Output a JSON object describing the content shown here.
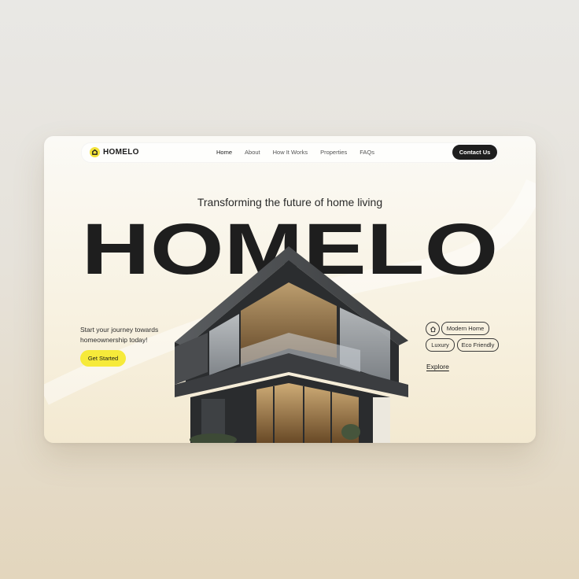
{
  "brand": {
    "logo_text": "HOMELO",
    "logo_icon": "house-icon",
    "accent": "#f6ea3a"
  },
  "nav": {
    "links": [
      "Home",
      "About",
      "How It Works",
      "Properties",
      "FAQs"
    ],
    "active": "Home",
    "contact_label": "Contact Us"
  },
  "hero": {
    "tagline": "Transforming the future of home living",
    "headline": "HOMELO",
    "journey_text": "Start your journey towards homeownership today!",
    "cta_label": "Get Started",
    "image": "modern-house-image"
  },
  "tags": {
    "home_icon": "house-outline-icon",
    "items": [
      "Modern Home",
      "Luxury",
      "Eco Friendly"
    ]
  },
  "explore_label": "Explore",
  "colors": {
    "dark": "#1e1e1e",
    "cta": "#f6ea3a",
    "card_bg": "#f8f2e2"
  }
}
